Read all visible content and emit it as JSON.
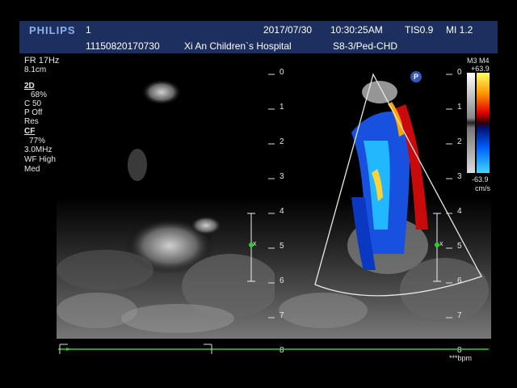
{
  "header": {
    "brand": "PHILIPS",
    "row1_left": "1",
    "date": "2017/07/30",
    "time": "10:30:25AM",
    "tis": "TIS0.9",
    "mi": "MI 1.2",
    "patient_id": "11150820170730",
    "hospital": "Xi  An Children`s Hospital",
    "probe": "S8-3/Ped-CHD"
  },
  "side_params": {
    "fr": "FR 17Hz",
    "depth": "8.1cm",
    "mode_2d": "2D",
    "gain_2d": "68%",
    "c_value": "C 50",
    "p_value": "P Off",
    "res": "Res",
    "mode_cf": "CF",
    "gain_cf": "77%",
    "freq": "3.0MHz",
    "wf": "WF High",
    "med": "Med"
  },
  "depth_scale": [
    "0",
    "1",
    "2",
    "3",
    "4",
    "5",
    "6",
    "7",
    "8"
  ],
  "colorbar": {
    "map_label": "M3  M4",
    "max": "+63.9",
    "min": "-63.9",
    "unit": "cm/s"
  },
  "badge": "P",
  "marker_x": "x",
  "bpm": "***bpm",
  "colors": {
    "header_bg": "#1d2f5e",
    "brand": "#8fb1ee",
    "timeline": "#2ad12a"
  }
}
